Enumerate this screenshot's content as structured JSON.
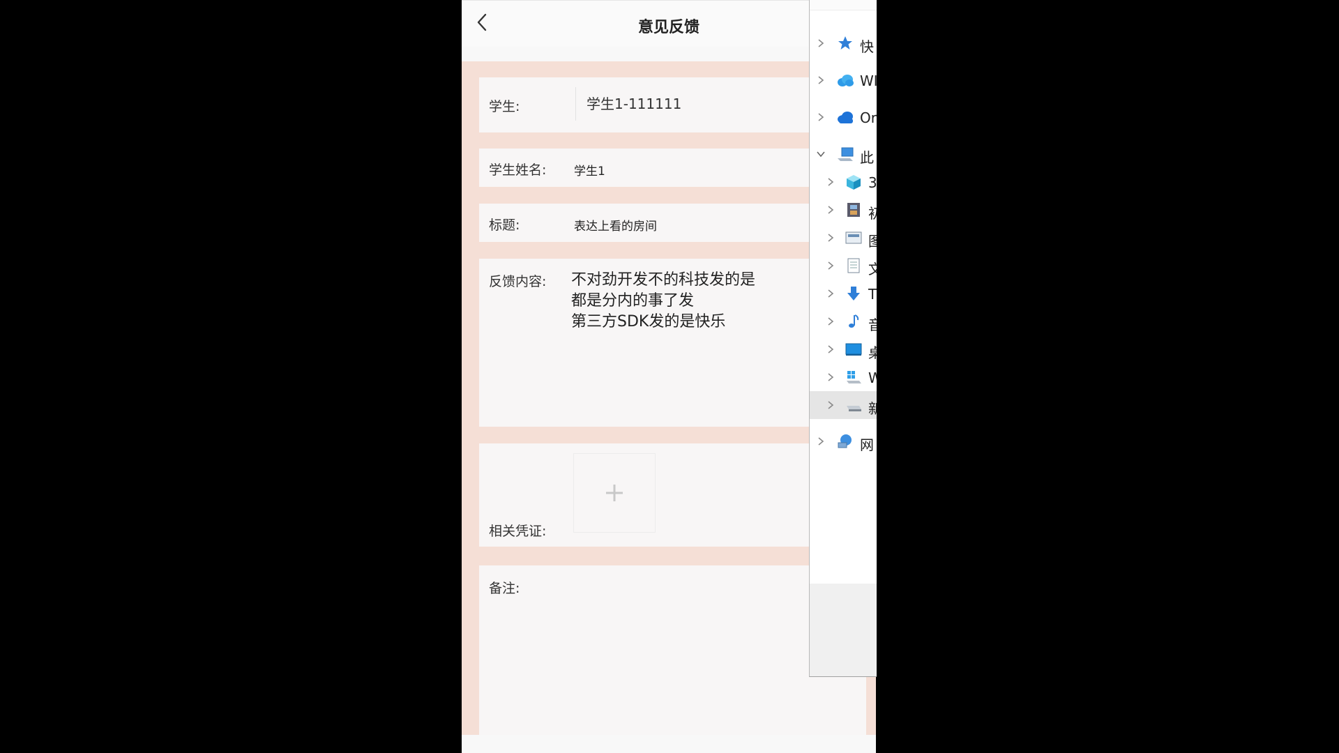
{
  "header": {
    "title": "意见反馈"
  },
  "form": {
    "student_label": "学生:",
    "student_value": "学生1-111111",
    "student_name_label": "学生姓名:",
    "student_name_value": "学生1",
    "subject_label": "标题:",
    "subject_value": "表达上看的房间",
    "content_label": "反馈内容:",
    "content_lines": [
      "不对劲开发不的科技发的是",
      "都是分内的事了发",
      "第三方SDK发的是快乐"
    ],
    "attachment_label": "相关凭证:",
    "remarks_label": "备注:"
  },
  "explorer": {
    "items": [
      {
        "label": "快",
        "icon": "star-icon",
        "expanded": false,
        "selected": false
      },
      {
        "label": "WI",
        "icon": "cloud-icon",
        "expanded": false,
        "selected": false
      },
      {
        "label": "Or",
        "icon": "onedrive-icon",
        "expanded": false,
        "selected": false
      },
      {
        "label": "此",
        "icon": "computer-icon",
        "expanded": true,
        "selected": false
      },
      {
        "label": "3",
        "icon": "3d-objects-icon",
        "expanded": false,
        "selected": false
      },
      {
        "label": "初",
        "icon": "video-icon",
        "expanded": false,
        "selected": false
      },
      {
        "label": "图",
        "icon": "pictures-icon",
        "expanded": false,
        "selected": false
      },
      {
        "label": "文",
        "icon": "documents-icon",
        "expanded": false,
        "selected": false
      },
      {
        "label": "T",
        "icon": "downloads-icon",
        "expanded": false,
        "selected": false
      },
      {
        "label": "音",
        "icon": "music-icon",
        "expanded": false,
        "selected": false
      },
      {
        "label": "桌",
        "icon": "desktop-icon",
        "expanded": false,
        "selected": false
      },
      {
        "label": "W",
        "icon": "windows-drive-icon",
        "expanded": false,
        "selected": false
      },
      {
        "label": "新",
        "icon": "drive-icon",
        "expanded": false,
        "selected": true
      },
      {
        "label": "网",
        "icon": "network-icon",
        "expanded": false,
        "selected": false
      }
    ]
  },
  "colors": {
    "form_background": "#f5dfd6",
    "card_background": "#f8f6f6",
    "onedrive_blue": "#1e73d8"
  }
}
